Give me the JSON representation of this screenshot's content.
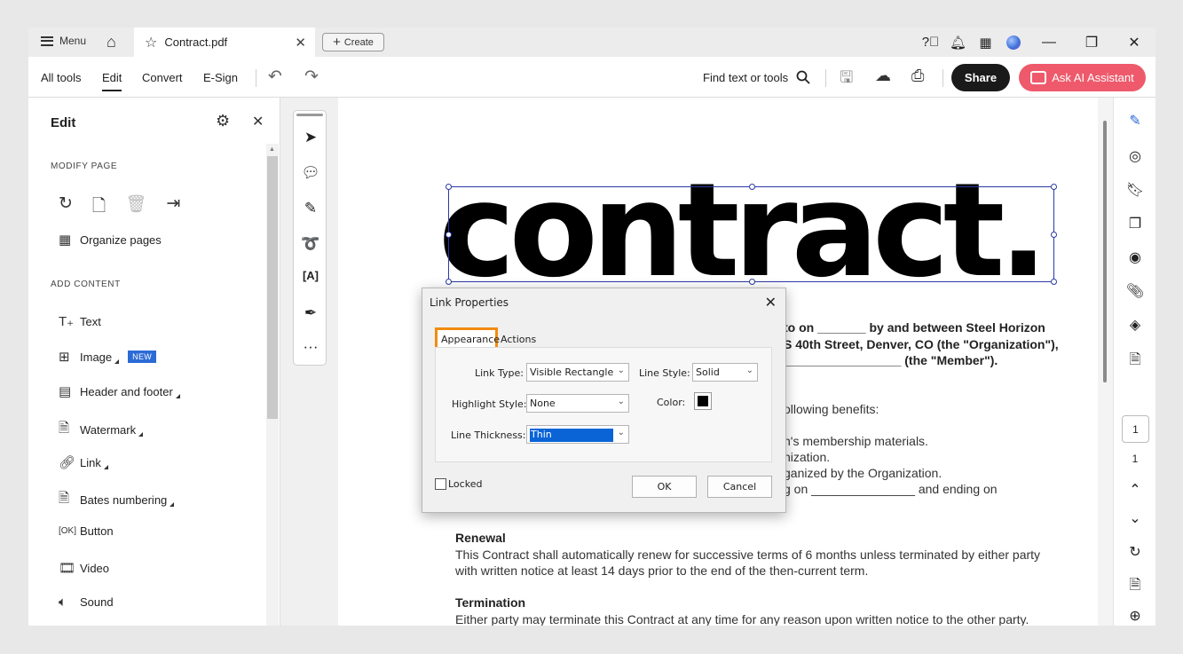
{
  "titlebar": {
    "menu_label": "Menu",
    "tab_title": "Contract.pdf",
    "create_label": "Create"
  },
  "toolbar": {
    "nav": [
      "All tools",
      "Edit",
      "Convert",
      "E-Sign"
    ],
    "find_label": "Find text or tools",
    "share_label": "Share",
    "ai_label": "Ask AI Assistant"
  },
  "left_panel": {
    "title": "Edit",
    "modify_section": "MODIFY PAGE",
    "organize_label": "Organize pages",
    "add_section": "ADD CONTENT",
    "items": {
      "text": "Text",
      "image": "Image",
      "image_badge": "NEW",
      "header_footer": "Header and footer",
      "watermark": "Watermark",
      "link": "Link",
      "bates": "Bates numbering",
      "button": "Button",
      "video": "Video",
      "sound": "Sound"
    }
  },
  "document": {
    "title": "contract.",
    "line1": "to on _______ by and between Steel Horizon",
    "line2": "S 40th Street, Denver, CO (the \"Organization\"),",
    "line3": "_________________ (the \"Member\").",
    "line4": "ollowing benefits:",
    "line5": "n's membership materials.",
    "line6": "nization.",
    "line7": "ganized by the Organization.",
    "line8": "g on _______________ and ending on",
    "renewal_heading": "Renewal",
    "renewal_1": "This Contract shall automatically renew for successive terms of 6 months unless terminated by either party",
    "renewal_2": "with written notice at least 14 days prior to the end of the then-current term.",
    "termination_heading": "Termination",
    "termination_1": "Either party may terminate this Contract at any time for any reason upon written notice to the other party."
  },
  "right_rail": {
    "page_input": "1",
    "page_total": "1"
  },
  "dialog": {
    "title": "Link Properties",
    "tab_appearance": "Appearance",
    "tab_actions": "Actions",
    "link_type_label": "Link Type:",
    "link_type_value": "Visible Rectangle",
    "line_style_label": "Line Style:",
    "line_style_value": "Solid",
    "highlight_label": "Highlight Style:",
    "highlight_value": "None",
    "color_label": "Color:",
    "color_value": "#000000",
    "thickness_label": "Line Thickness:",
    "thickness_value": "Thin",
    "locked_label": "Locked",
    "ok_label": "OK",
    "cancel_label": "Cancel"
  },
  "colors": {
    "share": "#1a1a1a",
    "ai_button": "#ee5a6b",
    "tab_highlight": "#f28b10",
    "selection": "#2a3aa6",
    "new_badge": "#2b6bd6"
  }
}
